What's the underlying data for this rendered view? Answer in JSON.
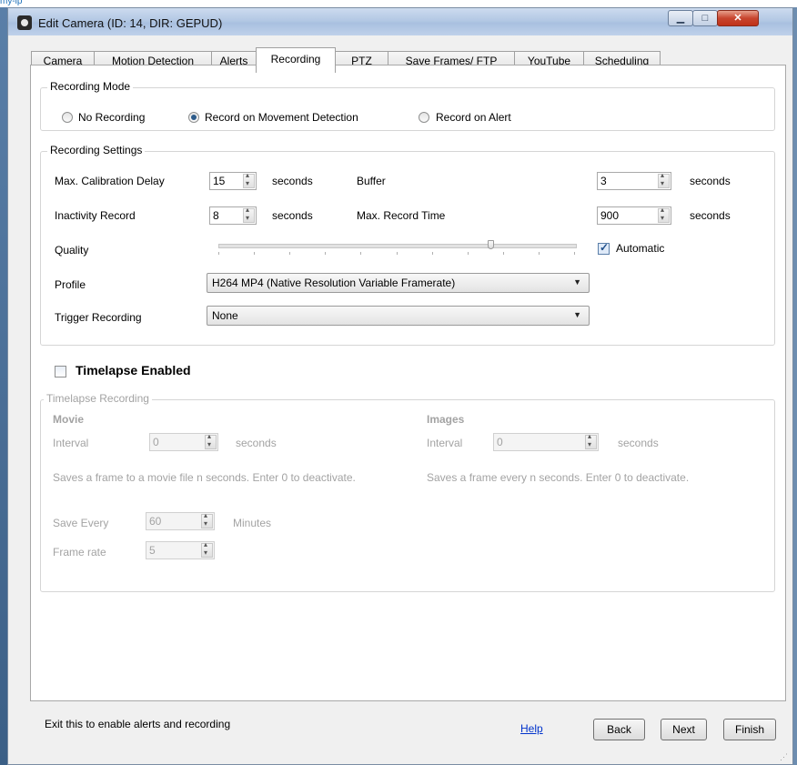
{
  "window": {
    "title": "Edit Camera (ID: 14, DIR: GEPUD)"
  },
  "top_strip_text": "my-ip",
  "tabs": [
    {
      "label": "Camera"
    },
    {
      "label": "Motion Detection"
    },
    {
      "label": "Alerts"
    },
    {
      "label": "Recording"
    },
    {
      "label": "PTZ"
    },
    {
      "label": "Save Frames/ FTP"
    },
    {
      "label": "YouTube"
    },
    {
      "label": "Scheduling"
    }
  ],
  "active_tab": "Recording",
  "recording_mode": {
    "title": "Recording Mode",
    "options": [
      "No Recording",
      "Record on Movement Detection",
      "Record on Alert"
    ],
    "selected": "Record on Movement Detection"
  },
  "recording_settings": {
    "title": "Recording Settings",
    "max_calibration_delay": {
      "label": "Max. Calibration Delay",
      "value": "15",
      "unit": "seconds"
    },
    "buffer": {
      "label": "Buffer",
      "value": "3",
      "unit": "seconds"
    },
    "inactivity_record": {
      "label": "Inactivity Record",
      "value": "8",
      "unit": "seconds"
    },
    "max_record_time": {
      "label": "Max. Record Time",
      "value": "900",
      "unit": "seconds"
    },
    "quality": {
      "label": "Quality",
      "level_fraction": 0.77,
      "automatic_label": "Automatic",
      "automatic_checked": true
    },
    "profile": {
      "label": "Profile",
      "value": "H264 MP4 (Native Resolution Variable Framerate)"
    },
    "trigger_recording": {
      "label": "Trigger Recording",
      "value": "None"
    }
  },
  "timelapse": {
    "enabled_label": "Timelapse Enabled",
    "enabled": false,
    "group_title": "Timelapse Recording",
    "movie": {
      "heading": "Movie",
      "interval_label": "Interval",
      "interval_value": "0",
      "interval_unit": "seconds",
      "description": "Saves a frame to a movie file n seconds. Enter 0 to deactivate.",
      "save_every_label": "Save Every",
      "save_every_value": "60",
      "save_every_unit": "Minutes",
      "frame_rate_label": "Frame rate",
      "frame_rate_value": "5"
    },
    "images": {
      "heading": "Images",
      "interval_label": "Interval",
      "interval_value": "0",
      "interval_unit": "seconds",
      "description": "Saves a frame every n seconds. Enter 0 to deactivate."
    }
  },
  "footer": {
    "status_text": "Exit this to enable alerts and recording",
    "help_link": "Help",
    "back_label": "Back",
    "next_label": "Next",
    "finish_label": "Finish"
  }
}
